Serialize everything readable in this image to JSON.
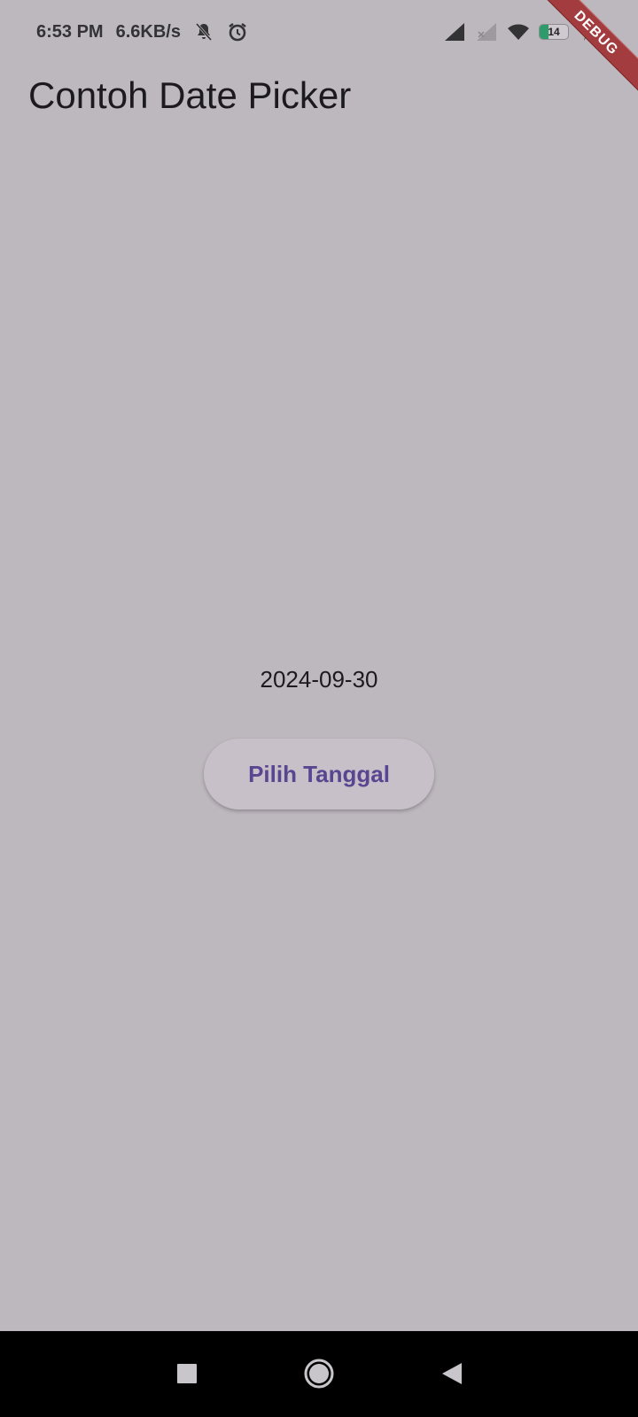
{
  "status_bar": {
    "time": "6:53 PM",
    "speed": "6.6KB/s",
    "icons_left": [
      "bell-off-icon",
      "alarm-icon"
    ],
    "icons_right": [
      "signal-icon",
      "signal-weak-icon",
      "wifi-icon",
      "battery-icon",
      "charging-icon"
    ],
    "battery_level": "14"
  },
  "debug_banner": {
    "label": "DEBUG"
  },
  "app_bar": {
    "title": "Contoh Date Picker"
  },
  "main": {
    "selected_date": "2024-09-30",
    "pick_button_label": "Pilih Tanggal"
  },
  "colors": {
    "background": "#bdb8be",
    "button_text": "#5a4591",
    "debug_ribbon": "#a33c3f",
    "nav_bar": "#000000"
  },
  "nav_bar": {
    "buttons": [
      "recent-apps",
      "home",
      "back"
    ]
  }
}
